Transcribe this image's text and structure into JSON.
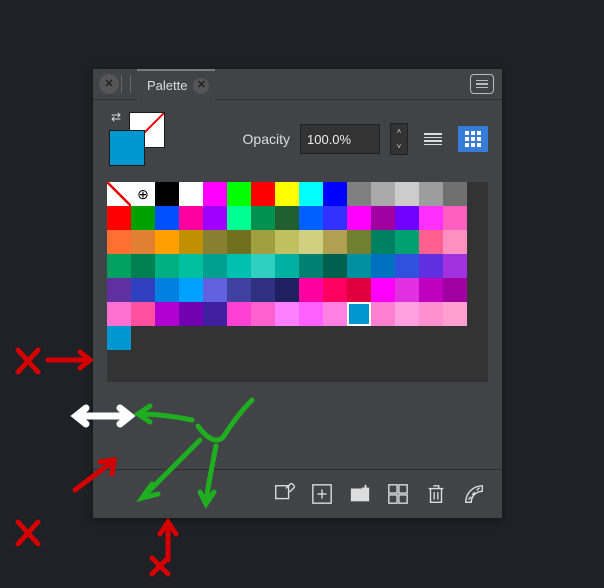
{
  "tab_title": "Palette",
  "opacity_label": "Opacity",
  "opacity_value": "100.0%",
  "icons": {
    "swap": "swap-colors-icon",
    "list_view": "list-view-icon",
    "grid_view": "grid-view-icon",
    "menu": "panel-menu-icon",
    "edit": "edit-swatch-icon",
    "add": "add-swatch-icon",
    "add_fill": "add-current-fill-icon",
    "add_global": "add-global-icon",
    "delete": "delete-swatch-icon",
    "palette_menu": "palette-library-icon"
  },
  "current_colors": {
    "foreground": "#0096cf",
    "background": "#ffffff"
  },
  "swatch_rows": [
    [
      "none",
      "reg",
      "#000000",
      "#ffffff",
      "#ff00ff",
      "#00ff00",
      "#ff0000",
      "#ffff00",
      "#00ffff",
      "#0000ff",
      "#808080",
      "#aaaaaa",
      "#cccccc",
      "#9d9d9d",
      "#707070"
    ],
    [
      "#ff0000",
      "#00a000",
      "#0050ff",
      "#ff00a0",
      "#a000ff",
      "#00ff90",
      "#009050",
      "#206030",
      "#0060ff",
      "#3030ff",
      "#ff00ff",
      "#a000a0",
      "#7000ff",
      "#ff30ff",
      "#ff60c0"
    ],
    [
      "#ff7030",
      "#e08030",
      "#ffa000",
      "#c09000",
      "#888030",
      "#707020",
      "#a0a040",
      "#c0c060",
      "#d0d080",
      "#b0a050",
      "#708030",
      "#008060",
      "#00a070",
      "#ff6090",
      "#ff90c0"
    ],
    [
      "#00a060",
      "#008050",
      "#00b080",
      "#00c0a0",
      "#00a090",
      "#00c0b0",
      "#30d0c0",
      "#00b0a0",
      "#008070",
      "#006050",
      "#0090a0",
      "#0070c0",
      "#3050e0",
      "#6030e0",
      "#a030e0"
    ],
    [
      "#6030a0",
      "#3040c0",
      "#0080e0",
      "#00a0ff",
      "#6060e0",
      "#4040a0",
      "#303080",
      "#202060",
      "#ff00a0",
      "#ff0060",
      "#e00040",
      "#ff00ff",
      "#e030e0",
      "#c000c0",
      "#a000a0"
    ],
    [
      "#ff70d0",
      "#ff50a0",
      "#b000d0",
      "#7000b0",
      "#4020a0",
      "#ff40d0",
      "#ff60d0",
      "#ff80ff",
      "#ff60ff",
      "#ff80e0",
      "#0096cf",
      "#ff80d0",
      "#ffa0e0",
      "#ff90d0",
      "#ffa0d0"
    ],
    [
      "#0096cf"
    ]
  ],
  "selected_swatch": {
    "row": 5,
    "col": 10
  },
  "annotations": [
    "red-x-left",
    "red-arrow-right",
    "white-double-arrow",
    "green-check",
    "green-arrows",
    "red-x-br",
    "red-arrows-up",
    "red-arrow-br2",
    "red-x-br2"
  ]
}
